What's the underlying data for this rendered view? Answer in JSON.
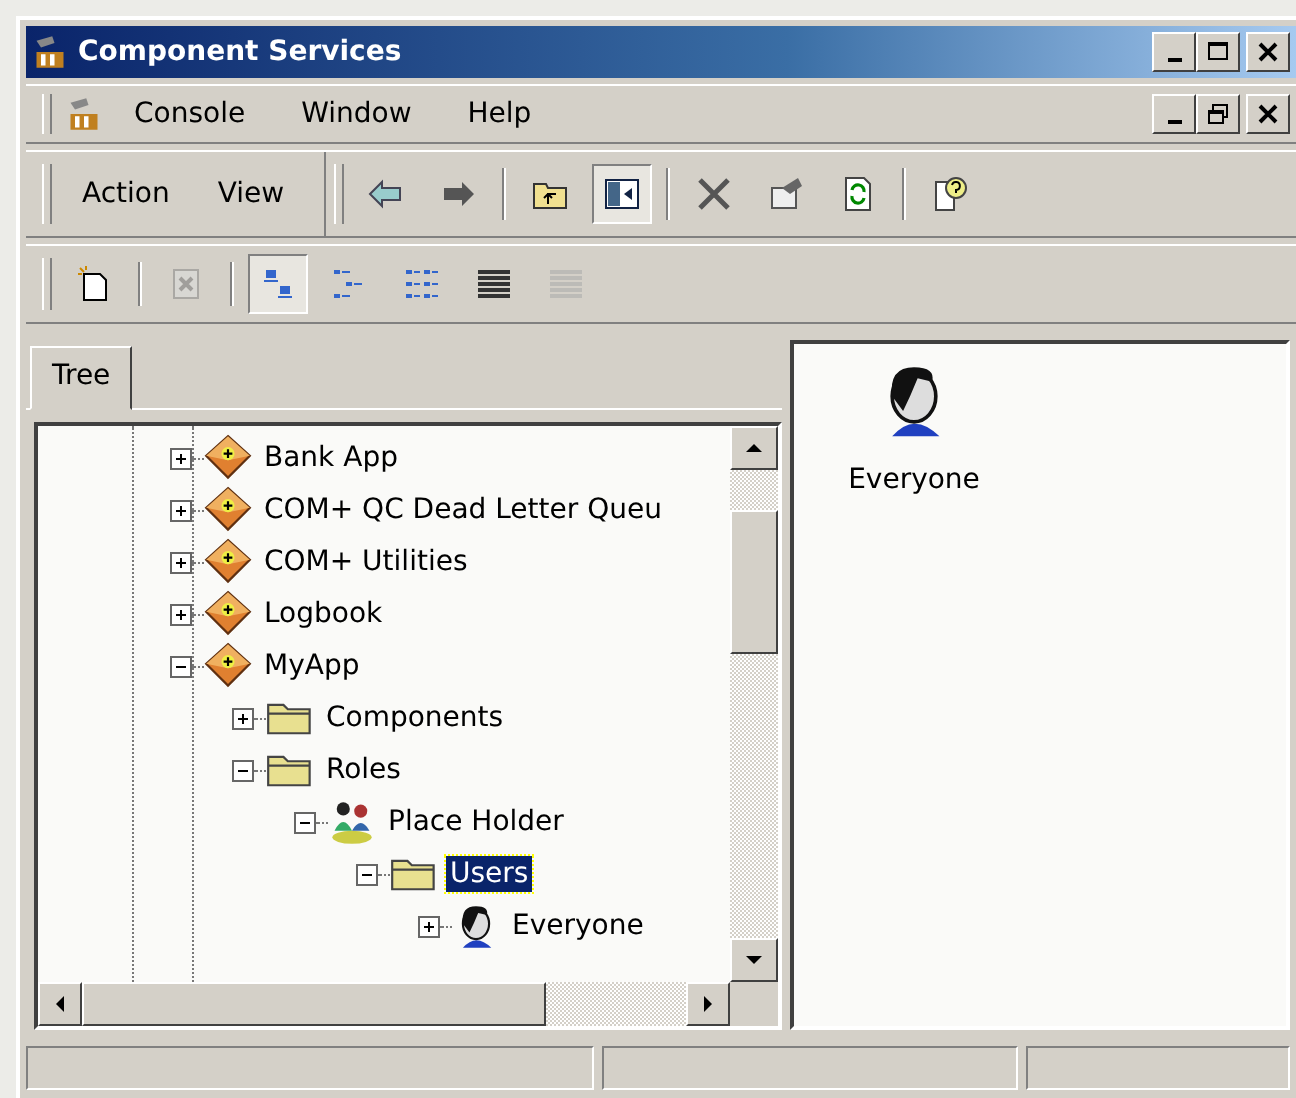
{
  "window": {
    "title": "Component Services"
  },
  "menu_bar": {
    "items": [
      "Console",
      "Window",
      "Help"
    ]
  },
  "action_bar": {
    "items": [
      "Action",
      "View"
    ]
  },
  "toolbar": [
    {
      "kind": "back",
      "pressed": false,
      "disabled": false
    },
    {
      "kind": "forward",
      "pressed": false,
      "disabled": false
    },
    {
      "kind": "up",
      "pressed": false,
      "disabled": false
    },
    {
      "kind": "pane",
      "pressed": true,
      "disabled": false
    },
    {
      "kind": "delete",
      "pressed": false,
      "disabled": false
    },
    {
      "kind": "properties",
      "pressed": false,
      "disabled": false
    },
    {
      "kind": "refresh",
      "pressed": false,
      "disabled": false
    },
    {
      "kind": "help",
      "pressed": false,
      "disabled": false
    }
  ],
  "view_toolbar": [
    {
      "kind": "new",
      "pressed": false,
      "disabled": false
    },
    {
      "kind": "remove",
      "pressed": false,
      "disabled": true
    },
    {
      "kind": "large",
      "pressed": true,
      "disabled": false
    },
    {
      "kind": "small",
      "pressed": false,
      "disabled": false
    },
    {
      "kind": "list",
      "pressed": false,
      "disabled": false
    },
    {
      "kind": "details",
      "pressed": false,
      "disabled": false
    },
    {
      "kind": "grid",
      "pressed": false,
      "disabled": true
    }
  ],
  "tabs": [
    {
      "label": "Tree",
      "selected": true
    }
  ],
  "tree": {
    "items": [
      {
        "label": "Bank App",
        "kind": "app",
        "expanded": false,
        "selected": false
      },
      {
        "label": "COM+ QC Dead Letter Queu",
        "kind": "app",
        "expanded": false,
        "selected": false
      },
      {
        "label": "COM+ Utilities",
        "kind": "app",
        "expanded": false,
        "selected": false
      },
      {
        "label": "Logbook",
        "kind": "app",
        "expanded": false,
        "selected": false
      },
      {
        "label": "MyApp",
        "kind": "app",
        "expanded": true,
        "selected": false,
        "children": [
          {
            "label": "Components",
            "kind": "folder",
            "expanded": false,
            "selected": false
          },
          {
            "label": "Roles",
            "kind": "folder",
            "expanded": true,
            "selected": false,
            "children": [
              {
                "label": "Place Holder",
                "kind": "role",
                "expanded": true,
                "selected": false,
                "children": [
                  {
                    "label": "Users",
                    "kind": "folder",
                    "expanded": true,
                    "selected": true,
                    "children": [
                      {
                        "label": "Everyone",
                        "kind": "user",
                        "expanded": false,
                        "selected": false
                      }
                    ]
                  }
                ]
              }
            ]
          }
        ]
      }
    ]
  },
  "details_pane": {
    "items": [
      {
        "label": "Everyone",
        "kind": "user"
      }
    ]
  }
}
